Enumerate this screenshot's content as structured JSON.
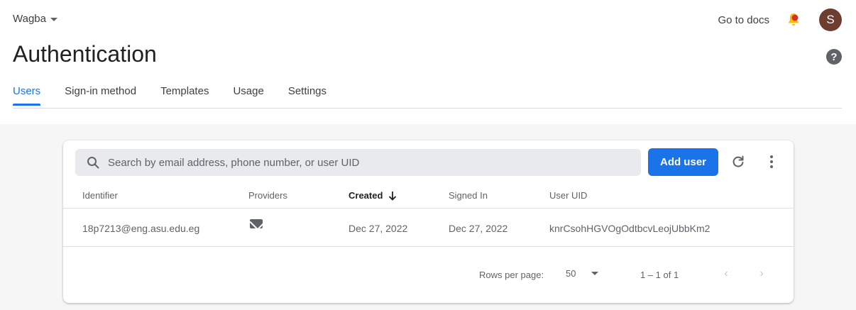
{
  "header": {
    "project_name": "Wagba",
    "docs_link": "Go to docs",
    "avatar_initial": "S"
  },
  "page": {
    "title": "Authentication",
    "help_symbol": "?"
  },
  "tabs": [
    {
      "label": "Users",
      "active": true
    },
    {
      "label": "Sign-in method",
      "active": false
    },
    {
      "label": "Templates",
      "active": false
    },
    {
      "label": "Usage",
      "active": false
    },
    {
      "label": "Settings",
      "active": false
    }
  ],
  "search": {
    "placeholder": "Search by email address, phone number, or user UID",
    "value": ""
  },
  "toolbar": {
    "add_user_label": "Add user"
  },
  "table": {
    "columns": [
      "Identifier",
      "Providers",
      "Created",
      "Signed In",
      "User UID"
    ],
    "sorted_column": "Created",
    "sort_direction": "descending",
    "rows": [
      {
        "identifier": "18p7213@eng.asu.edu.eg",
        "provider_icon": "email-icon",
        "created": "Dec 27, 2022",
        "signed_in": "Dec 27, 2022",
        "uid": "knrCsohHGVOgOdtbcvLeojUbbKm2"
      }
    ]
  },
  "pagination": {
    "rows_per_page_label": "Rows per page:",
    "rows_per_page_value": "50",
    "range_label": "1 – 1 of 1"
  },
  "colors": {
    "accent": "#1a73e8",
    "avatar_bg": "#6d3d2f",
    "notification_dot": "#d93025"
  }
}
